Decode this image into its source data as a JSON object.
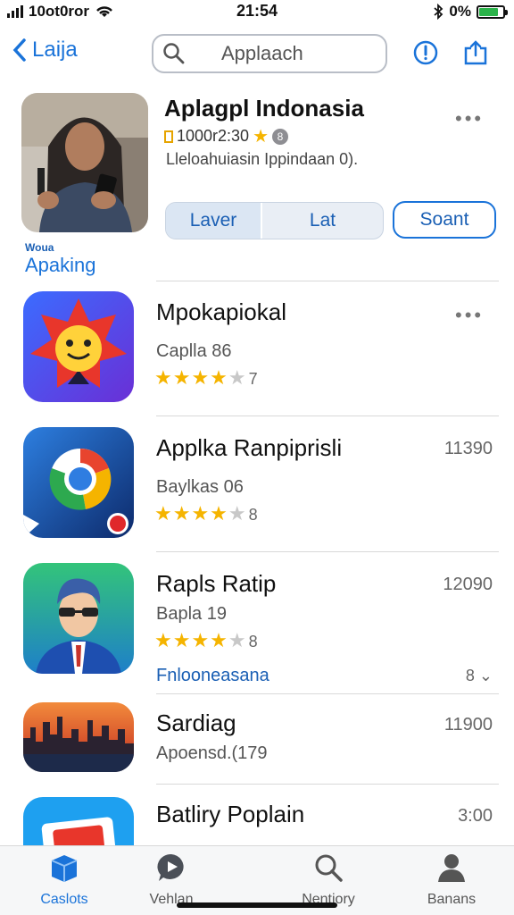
{
  "status_bar": {
    "carrier": "10ot0ror",
    "time": "21:54",
    "battery_text": "0%",
    "battery_level": 0.8
  },
  "nav": {
    "back_label": "Laija",
    "search_placeholder": "Applaach"
  },
  "featured": {
    "title": "Aplagpl Indonasia",
    "meta": "1000r2:30",
    "description": "Lleloahuiasin Ippindaan 0).",
    "seg_left": "Laver",
    "seg_right": "Lat",
    "start_label": "Soant",
    "brand_small": "Woua",
    "brand_big": "Apaking"
  },
  "apps": [
    {
      "title": "Mpokapiokal",
      "subtitle": "Caplla 86",
      "rating": 4,
      "rating_count": "7",
      "right": "",
      "link": "",
      "icon": "sun-face-icon"
    },
    {
      "title": "Applka Ranpiprisli",
      "subtitle": "Baylkas 06",
      "rating": 4,
      "rating_count": "8",
      "right": "11390",
      "link": "",
      "icon": "browser-icon"
    },
    {
      "title": "Rapls Ratip",
      "subtitle": "Bapla 19",
      "rating": 4,
      "rating_count": "8",
      "right": "12090",
      "link": "Fnlooneasana",
      "link_right": "8",
      "icon": "avatar-man-icon"
    },
    {
      "title": "Sardiag",
      "subtitle": "Apoensd.(179",
      "right": "11900",
      "icon": "city-skyline-icon"
    },
    {
      "title": "Batliry Poplain",
      "subtitle": "",
      "right": "3:00",
      "icon": "store-icon"
    }
  ],
  "tabs": [
    {
      "label": "Caslots",
      "icon": "cube-icon",
      "active": true
    },
    {
      "label": "Vehlan",
      "icon": "play-bubble-icon",
      "active": false
    },
    {
      "label": "Nentiory",
      "icon": "search-icon",
      "active": false
    },
    {
      "label": "Banans",
      "icon": "person-icon",
      "active": false
    }
  ],
  "colors": {
    "accent": "#1a73d9",
    "star": "#f5b400",
    "divider": "#d9d9d9"
  }
}
